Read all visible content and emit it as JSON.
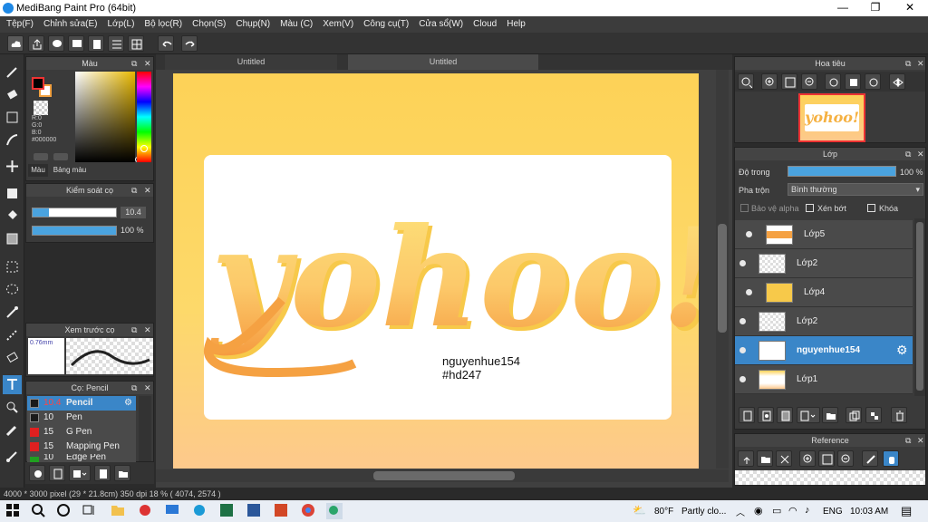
{
  "window": {
    "title": "MediBang Paint Pro (64bit)",
    "minimize": "—",
    "maximize": "❐",
    "close": "✕"
  },
  "menu": [
    "Tệp(F)",
    "Chỉnh sửa(E)",
    "Lớp(L)",
    "Bộ lọc(R)",
    "Chọn(S)",
    "Chụp(N)",
    "Màu (C)",
    "Xem(V)",
    "Công cụ(T)",
    "Cửa sổ(W)",
    "Cloud",
    "Help"
  ],
  "color_panel": {
    "title": "Màu",
    "r": "R:0",
    "g": "G:0",
    "b": "B:0",
    "hex": "#000000",
    "tab_color": "Màu",
    "tab_palette": "Bảng màu"
  },
  "brush_control": {
    "title": "Kiểm soát cọ",
    "size": "10.4",
    "opacity": "100 %",
    "opacity_fraction": 1.0
  },
  "brush_preview": {
    "title": "Xem trước cọ",
    "size": "0.76mm"
  },
  "brush_list": {
    "title": "Cọ: Pencil",
    "items": [
      {
        "size": "10.4",
        "name": "Pencil",
        "color": "#1a1a1a",
        "selected": true
      },
      {
        "size": "10",
        "name": "Pen",
        "color": "#1a1a1a",
        "selected": false
      },
      {
        "size": "15",
        "name": "G Pen",
        "color": "#e02020",
        "selected": false
      },
      {
        "size": "15",
        "name": "Mapping Pen",
        "color": "#e02020",
        "selected": false
      },
      {
        "size": "10",
        "name": "Edge Pen",
        "color": "#20a020",
        "selected": false
      }
    ]
  },
  "canvas": {
    "tabs": [
      "Untitled",
      "Untitled"
    ],
    "artwork_text": "yohoo!",
    "caption_line1": "nguyenhue154",
    "caption_line2": "#hd247"
  },
  "navigator": {
    "title": "Hoa tiêu"
  },
  "layer_panel": {
    "title": "Lớp",
    "opacity_label": "Độ trong",
    "opacity_value": "100 %",
    "opacity_fraction": 1.0,
    "blend_label": "Pha trộn",
    "blend_value": "Bình thường",
    "protect_alpha": "Bảo vệ alpha",
    "clipping": "Xén bớt",
    "lock": "Khóa",
    "layers": [
      {
        "name": "Lớp5",
        "selected": false,
        "indent": true
      },
      {
        "name": "Lớp2",
        "selected": false,
        "indent": false
      },
      {
        "name": "Lớp4",
        "selected": false,
        "indent": true
      },
      {
        "name": "Lớp2",
        "selected": false,
        "indent": false
      },
      {
        "name": "nguyenhue154",
        "selected": true,
        "indent": false
      },
      {
        "name": "Lớp1",
        "selected": false,
        "indent": false
      }
    ]
  },
  "reference_panel": {
    "title": "Reference"
  },
  "statusbar": {
    "text": "4000 * 3000 pixel   (29 * 21.8cm)   350 dpi   18 %   ( 4074, 2574 )"
  },
  "taskbar": {
    "weather_temp": "80°F",
    "weather_text": "Partly clo...",
    "lang": "ENG",
    "time": "10:03 AM"
  },
  "colors": {
    "accent": "#4aa3df",
    "selected_layer": "#3a86c8",
    "canvas_bg": "#fdd257",
    "text_orange": "#f5a142"
  }
}
